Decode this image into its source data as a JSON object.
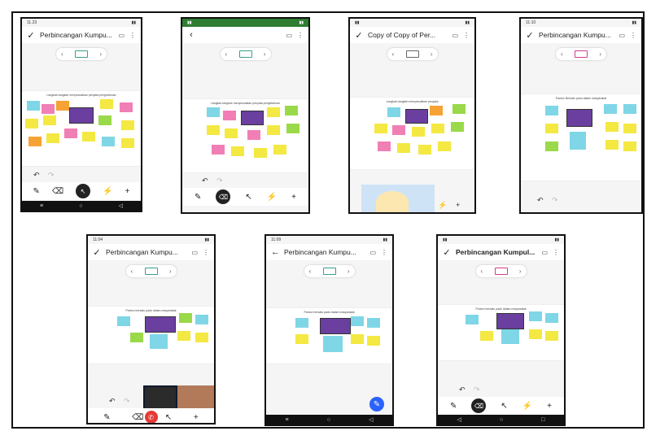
{
  "phones": [
    {
      "id": "p1",
      "status_left": "11.23",
      "title": "Perbincangan Kumpu...",
      "nav": "✓",
      "frame_title": "Langkah-langkah menyesuaikan penyata pengetahuan"
    },
    {
      "id": "p2",
      "status_left": "",
      "title": "",
      "nav": "‹",
      "frame_title": "Langkah-langkah menyesuaikan penyata pengetahuan"
    },
    {
      "id": "p3",
      "status_left": "",
      "title": "Copy of Copy of Per...",
      "nav": "✓",
      "frame_title": "Langkah-langkah menyesuaikan penyata"
    },
    {
      "id": "p4",
      "status_left": "11:10",
      "title": "Perbincangan Kumpu...",
      "nav": "✓",
      "frame_title": "Pantun Bersatu padu dalam masyarakat"
    },
    {
      "id": "p5",
      "status_left": "11:04",
      "title": "Perbincangan Kumpu...",
      "nav": "✓",
      "frame_title": "Pantun bersatu padu dalam masyarakat"
    },
    {
      "id": "p6",
      "status_left": "11:09",
      "title": "Perbincangan Kumpu...",
      "nav": "←",
      "frame_title": "Pantun bersatu padu dalam masyarakat"
    },
    {
      "id": "p7",
      "status_left": "",
      "title": "Perbincangan Kumpul...",
      "nav": "✓",
      "frame_title": "Pantun bersatu padu dalam masyarakat"
    }
  ],
  "icons": {
    "cast": "cast-icon",
    "more": "more-vert-icon",
    "undo": "undo-icon",
    "redo": "redo-icon",
    "pen": "pen-icon",
    "eraser": "eraser-icon",
    "select": "select-icon",
    "laser": "laser-icon",
    "add": "add-icon"
  },
  "colors": {
    "accent": "#3a9d8f",
    "fab": "#2962ff",
    "endcall": "#e53935",
    "note_yellow": "#f4e842",
    "note_cyan": "#7fd6e6",
    "note_pink": "#f07fb5",
    "note_green": "#9ad94a",
    "note_orange": "#f7a234"
  }
}
